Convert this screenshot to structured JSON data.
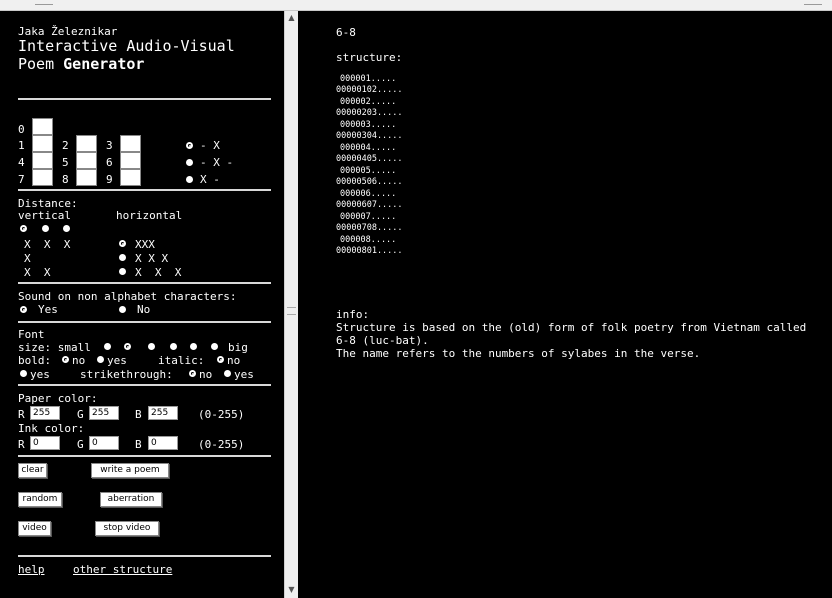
{
  "left": {
    "author": "Jaka Železnikar",
    "title_line1": "Interactive Audio-Visual",
    "title_line2_a": "Poem ",
    "title_line2_b": "Generator",
    "grid": {
      "labels": [
        "0",
        "1",
        "2",
        "3",
        "4",
        "5",
        "6",
        "7",
        "8",
        "9"
      ],
      "pattern_options": [
        "- X",
        "- X -",
        "X -"
      ]
    },
    "distance": {
      "heading": "Distance:",
      "vertical_label": "vertical",
      "horizontal_label": "horizontal",
      "vertical_samples": [
        "X  X  X",
        "X",
        "X  X"
      ],
      "horizontal_options": [
        "XXX",
        "X X X",
        "X  X  X"
      ]
    },
    "sound": {
      "heading": "Sound on non alphabet characters:",
      "yes": "Yes",
      "no": "No"
    },
    "font": {
      "heading": "Font",
      "size_label": "size: small",
      "size_big": "big",
      "bold_label": "bold:",
      "bold_no": "no",
      "bold_yes": "yes",
      "italic_label": "italic:",
      "italic_no": "no",
      "italic_yes": "yes",
      "strike_label": "strikethrough:",
      "strike_no": "no",
      "strike_yes": "yes"
    },
    "paper": {
      "heading": "Paper color:",
      "r_label": "R",
      "g_label": "G",
      "b_label": "B",
      "r": "255",
      "g": "255",
      "b": "255",
      "range": "(0-255)"
    },
    "ink": {
      "heading": "Ink color:",
      "r_label": "R",
      "g_label": "G",
      "b_label": "B",
      "r": "0",
      "g": "0",
      "b": "0",
      "range": "(0-255)"
    },
    "buttons": {
      "clear": "clear",
      "write": "write a poem",
      "random": "random",
      "aberration": "aberration",
      "video": "video",
      "stop_video": "stop video"
    },
    "links": {
      "help": "help",
      "other": "other structure"
    }
  },
  "right": {
    "header": "6-8",
    "structure_heading": "structure:",
    "structure_lines": [
      "000001.....",
      "00000102.....",
      "000002.....",
      "00000203.....",
      "000003.....",
      "00000304.....",
      "000004.....",
      "00000405.....",
      "000005.....",
      "00000506.....",
      "000006.....",
      "00000607.....",
      "000007.....",
      "00000708.....",
      "000008.....",
      "00000801....."
    ],
    "info_heading": "info:",
    "info_line1": "Structure is based on the (old) form of folk poetry from Vietnam called",
    "info_line2": "6-8 (luc-bat).",
    "info_line3": "The name refers to the numbers of sylabes in the verse."
  }
}
